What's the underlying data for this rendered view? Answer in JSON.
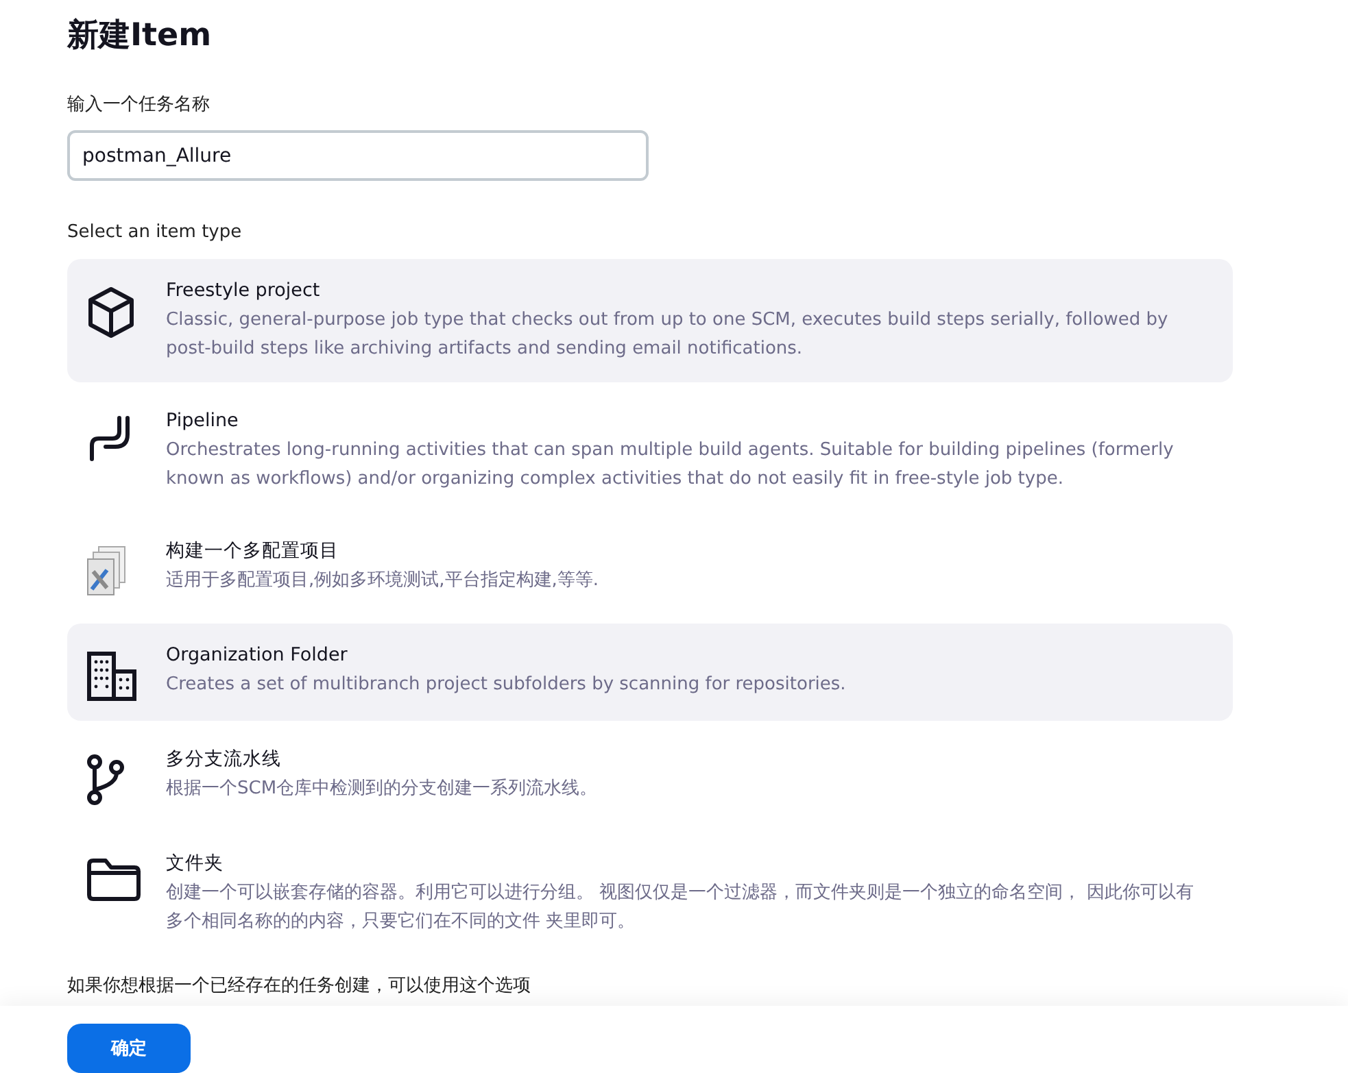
{
  "title": "新建Item",
  "name_field": {
    "label": "输入一个任务名称",
    "value": "postman_Allure"
  },
  "type_heading": "Select an item type",
  "item_types": [
    {
      "kind": "cube",
      "title": "Freestyle project",
      "description": "Classic, general-purpose job type that checks out from up to one SCM, executes build steps serially, followed by post-build steps like archiving artifacts and sending email notifications.",
      "highlighted": true
    },
    {
      "kind": "pipeline",
      "title": "Pipeline",
      "description": "Orchestrates long-running activities that can span multiple build agents. Suitable for building pipelines (formerly known as workflows) and/or organizing complex activities that do not easily fit in free-style job type.",
      "highlighted": false
    },
    {
      "kind": "matrix",
      "title": "构建一个多配置项目",
      "description": "适用于多配置项目,例如多环境测试,平台指定构建,等等.",
      "highlighted": false
    },
    {
      "kind": "building",
      "title": "Organization Folder",
      "description": "Creates a set of multibranch project subfolders by scanning for repositories.",
      "highlighted": true
    },
    {
      "kind": "branch",
      "title": "多分支流水线",
      "description": "根据一个SCM仓库中检测到的分支创建一系列流水线。",
      "highlighted": false
    },
    {
      "kind": "folder",
      "title": "文件夹",
      "description": "创建一个可以嵌套存储的容器。利用它可以进行分组。 视图仅仅是一个过滤器，而文件夹则是一个独立的命名空间， 因此你可以有多个相同名称的的内容，只要它们在不同的文件 夹里即可。",
      "highlighted": false
    }
  ],
  "copy_hint": "如果你想根据一个已经存在的任务创建，可以使用这个选项",
  "ok_button": "确定"
}
